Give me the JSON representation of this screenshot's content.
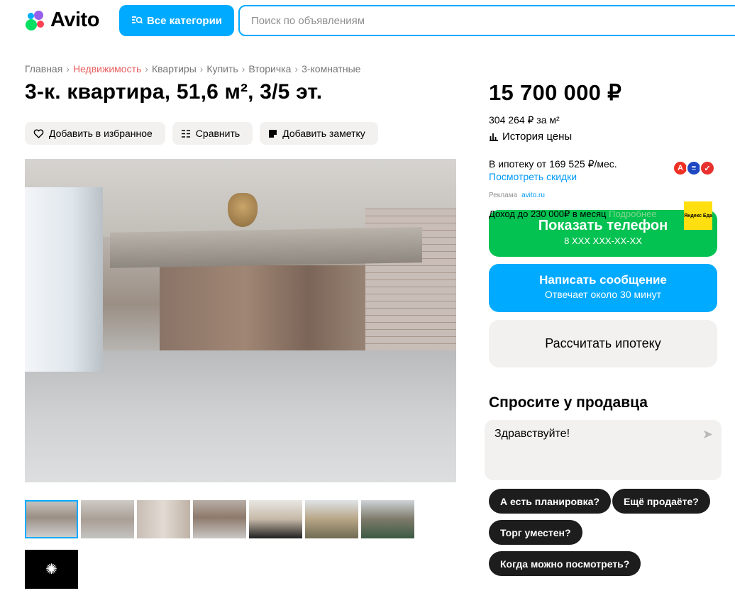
{
  "header": {
    "logo_text": "Avito",
    "categories_button": "Все категории",
    "search_placeholder": "Поиск по объявлениям"
  },
  "breadcrumbs": [
    "Главная",
    "Недвижимость",
    "Квартиры",
    "Купить",
    "Вторичка",
    "3-комнатные"
  ],
  "listing": {
    "title": "3-к. квартира, 51,6 м², 3/5 эт.",
    "actions": {
      "favorite": "Добавить в избранное",
      "compare": "Сравнить",
      "note": "Добавить заметку"
    }
  },
  "gallery": {
    "thumb_count": 7,
    "selected_index": 0
  },
  "price": {
    "value": "15 700 000 ₽",
    "per_m2": "304 264 ₽ за м²",
    "history_link": "История цены"
  },
  "mortgage": {
    "text": "В ипотеку от 169 525 ₽/мес.",
    "discounts_link": "Посмотреть скидки"
  },
  "ad": {
    "label": "Реклама",
    "source": "avito.ru",
    "text": "Доход до 230 000₽ в месяц",
    "more": "Подробнее",
    "logo_text": "Яндекс Еда"
  },
  "contact": {
    "call_label": "Показать телефон",
    "call_phone": "8 XXX XXX-XX-XX",
    "message_label": "Написать сообщение",
    "message_sub": "Отвечает около 30 минут",
    "calc_label": "Рассчитать ипотеку"
  },
  "ask_seller": {
    "title": "Спросите у продавца",
    "message": "Здравствуйте!",
    "quick_questions": [
      "А есть планировка?",
      "Ещё продаёте?",
      "Торг уместен?",
      "Когда можно посмотреть?"
    ]
  },
  "colors": {
    "accent": "#00aaff",
    "call_green": "#04c251",
    "link_blue": "#0099f7",
    "crumb_highlight": "#e86060"
  }
}
